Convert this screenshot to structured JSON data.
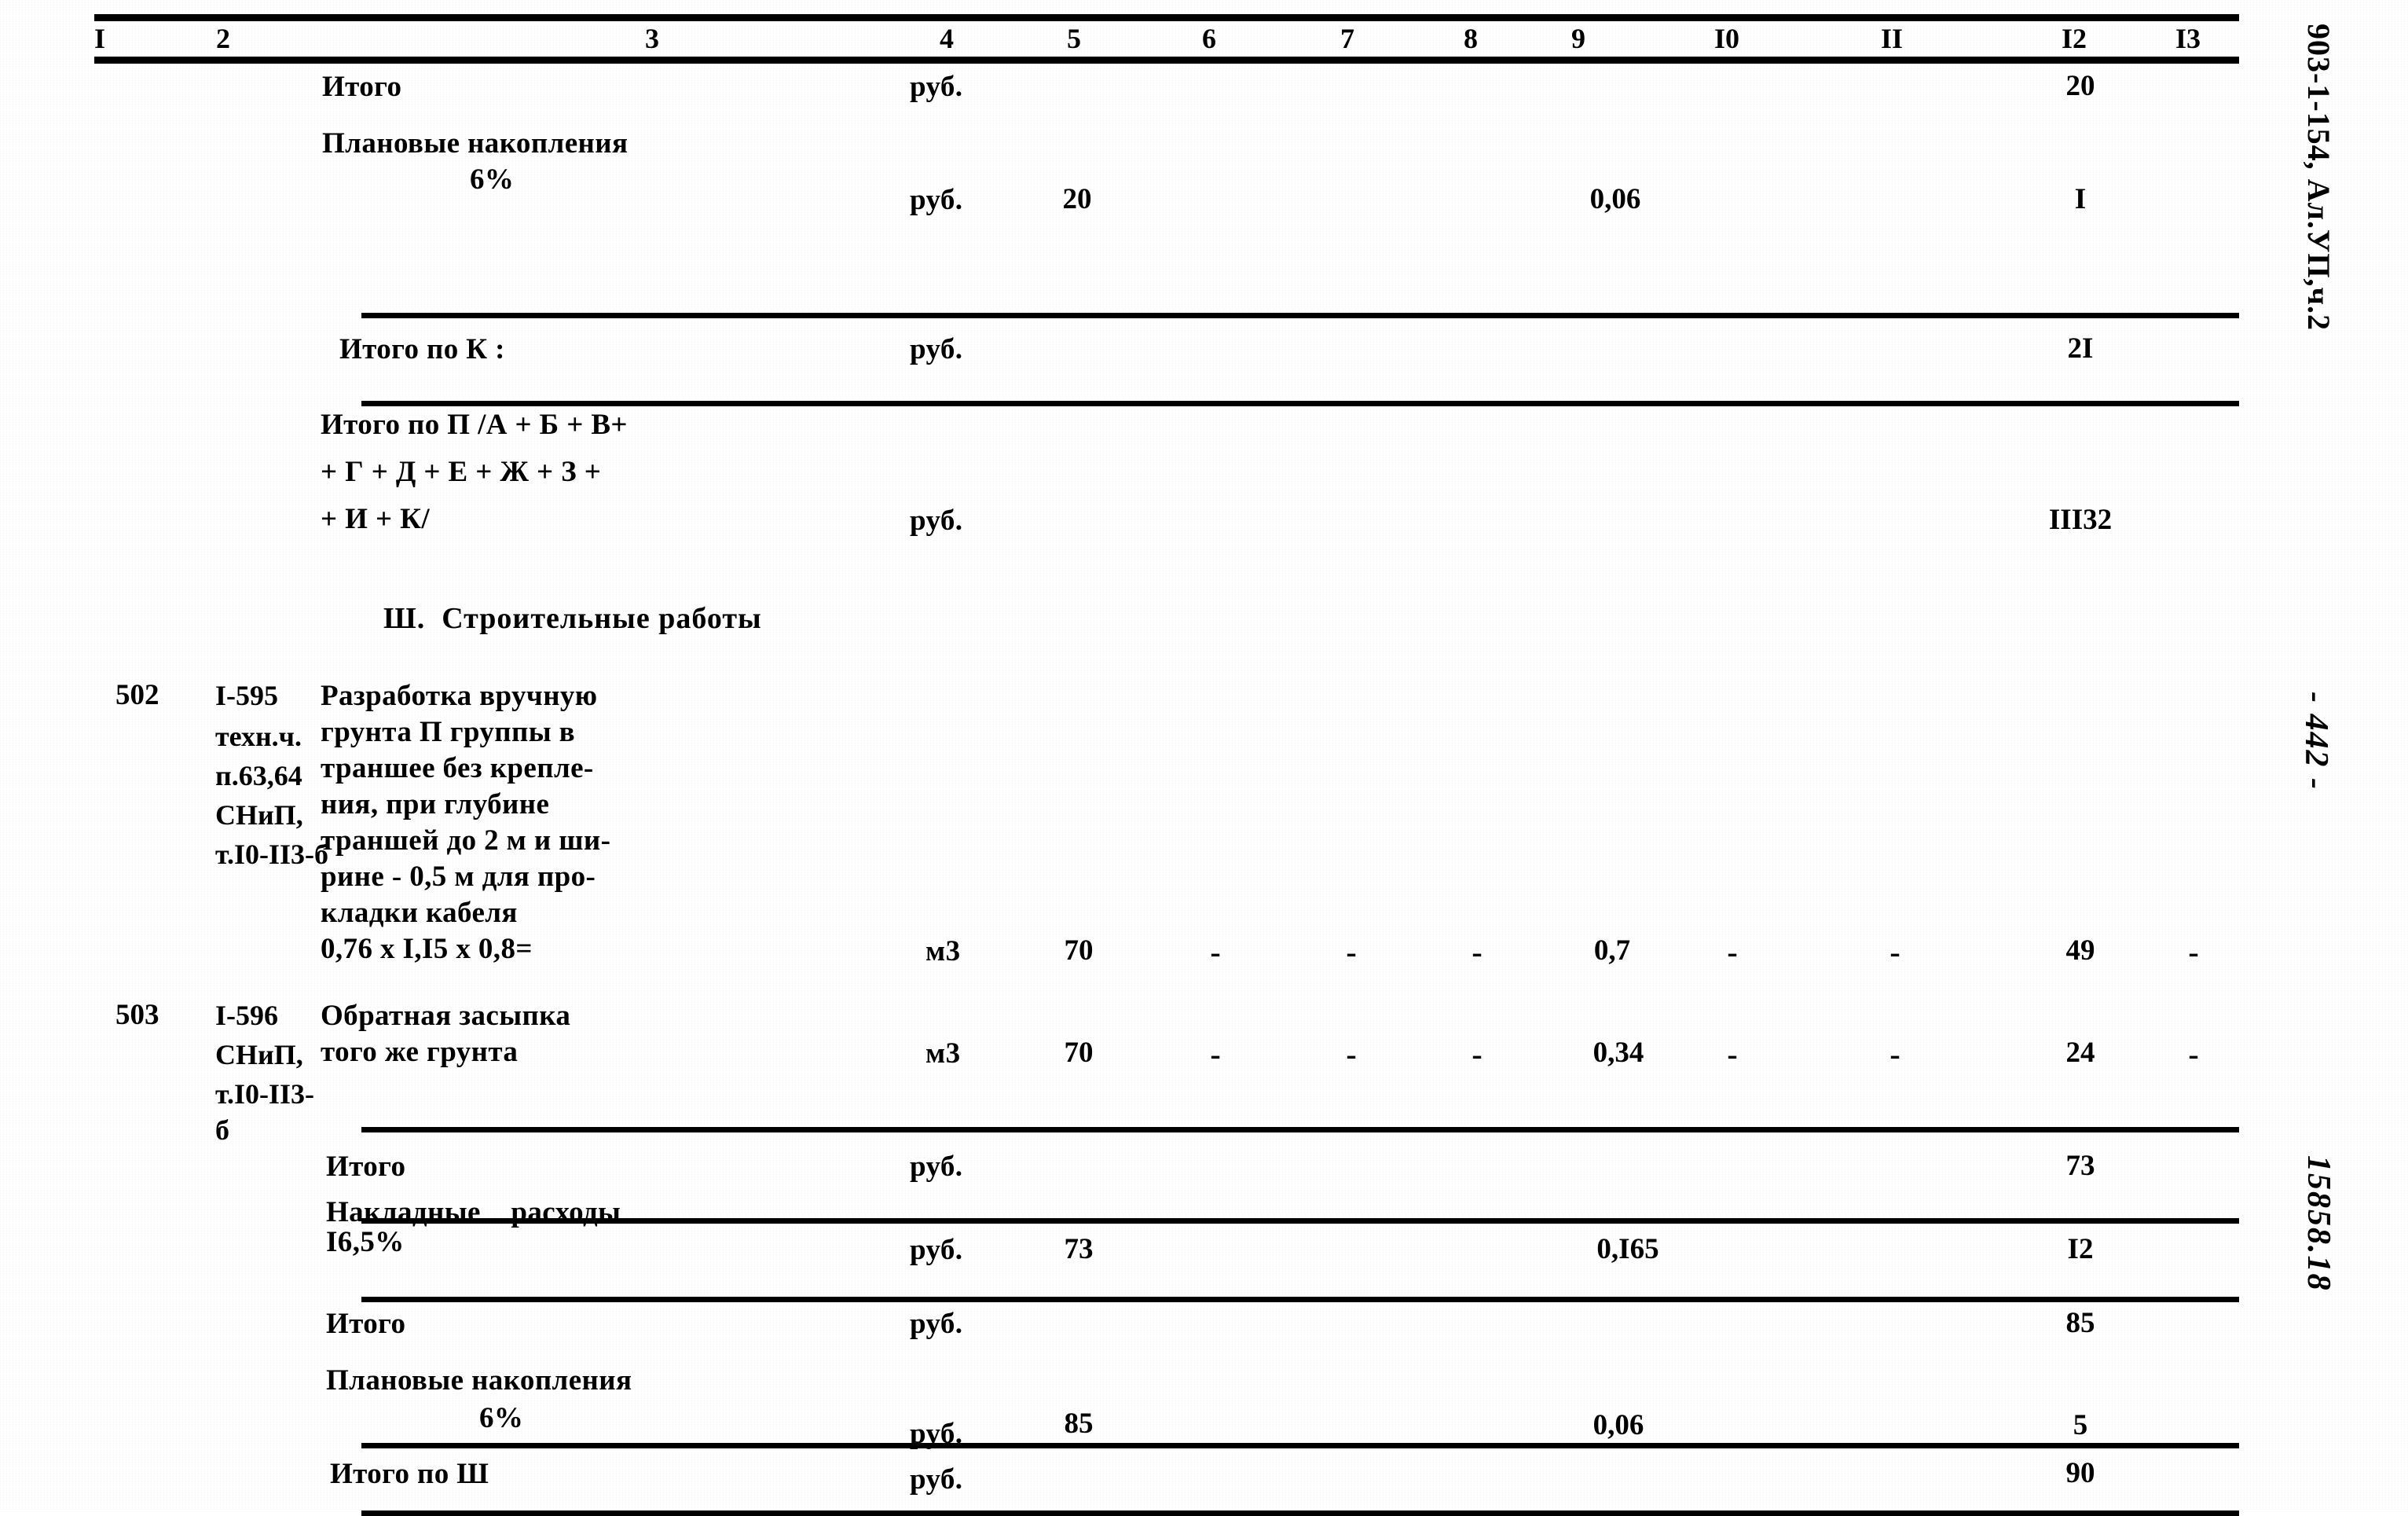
{
  "document": {
    "kind": "soviet-construction-estimate-sheet",
    "page_number_label": "- 442 -",
    "album_ref": "903-1-154, Ал.УП,ч.2",
    "archive_code": "15858.18"
  },
  "table": {
    "column_headers": [
      "I",
      "2",
      "3",
      "4",
      "5",
      "6",
      "7",
      "8",
      "9",
      "I0",
      "II",
      "I2",
      "I3"
    ],
    "rows": [
      {
        "kind": "total",
        "c1": "",
        "c2": "",
        "desc": "Итого",
        "unit": "руб.",
        "c5": "",
        "c6": "",
        "c7": "",
        "c8": "",
        "c9": "",
        "c10": "",
        "c11": "",
        "c12": "20",
        "c13": ""
      },
      {
        "kind": "total",
        "c1": "",
        "c2": "",
        "desc": "Плановые накопления",
        "desc2": "6%",
        "unit": "руб.",
        "c5": "20",
        "c6": "",
        "c7": "",
        "c8": "",
        "c9": "0,06",
        "c10": "",
        "c11": "",
        "c12": "I",
        "c13": ""
      },
      {
        "kind": "subtotal",
        "c1": "",
        "c2": "",
        "desc": "Итого по К :",
        "unit": "руб.",
        "c5": "",
        "c6": "",
        "c7": "",
        "c8": "",
        "c9": "",
        "c10": "",
        "c11": "",
        "c12": "2I",
        "c13": ""
      },
      {
        "kind": "grandtotal",
        "c1": "",
        "c2": "",
        "desc_lines": [
          "Итого по П /А + Б + В+",
          "+ Г + Д + Е + Ж + З +",
          "+ И + К/"
        ],
        "unit": "руб.",
        "c5": "",
        "c6": "",
        "c7": "",
        "c8": "",
        "c9": "",
        "c10": "",
        "c11": "",
        "c12": "III32",
        "c13": ""
      },
      {
        "kind": "section-heading",
        "heading": "Ш.  Строительные работы"
      },
      {
        "kind": "item",
        "c1": "502",
        "c2_lines": [
          "I-595",
          "техн.ч.",
          "п.63,64",
          "СНиП,",
          "т.I0-II3-б"
        ],
        "desc_lines": [
          "Разработка вручную",
          "грунта П группы в",
          "траншее без крепле-",
          "ния, при глубине",
          "траншей до 2 м и ши-",
          "рине - 0,5 м для про-",
          "кладки кабеля",
          "0,76 х I,I5 х 0,8="
        ],
        "unit": "м3",
        "c5": "70",
        "c6": "-",
        "c7": "-",
        "c8": "-",
        "c9": "0,7",
        "c10": "-",
        "c11": "-",
        "c12": "49",
        "c13": "-"
      },
      {
        "kind": "item",
        "c1": "503",
        "c2_lines": [
          "I-596",
          "СНиП,",
          "т.I0-II3-",
          "б"
        ],
        "desc_lines": [
          "Обратная засыпка",
          "того же грунта"
        ],
        "unit": "м3",
        "c5": "70",
        "c6": "-",
        "c7": "-",
        "c8": "-",
        "c9": "0,34",
        "c10": "-",
        "c11": "-",
        "c12": "24",
        "c13": "-"
      },
      {
        "kind": "total",
        "desc": "Итого",
        "unit": "руб.",
        "c5": "",
        "c9": "",
        "c12": "73",
        "c13": ""
      },
      {
        "kind": "total",
        "desc": "Накладные    расходы",
        "desc2": "I6,5%",
        "unit": "руб.",
        "c5": "73",
        "c9": "0,I65",
        "c12": "I2",
        "c13": ""
      },
      {
        "kind": "total",
        "desc": "Итого",
        "unit": "руб.",
        "c5": "",
        "c9": "",
        "c12": "85",
        "c13": ""
      },
      {
        "kind": "total",
        "desc": "Плановые накопления",
        "desc2": "6%",
        "unit": "руб.",
        "c5": "85",
        "c9": "0,06",
        "c12": "5",
        "c13": ""
      },
      {
        "kind": "subtotal",
        "desc": "Итого по Ш",
        "unit": "руб.",
        "c5": "",
        "c9": "",
        "c12": "90",
        "c13": ""
      }
    ]
  }
}
